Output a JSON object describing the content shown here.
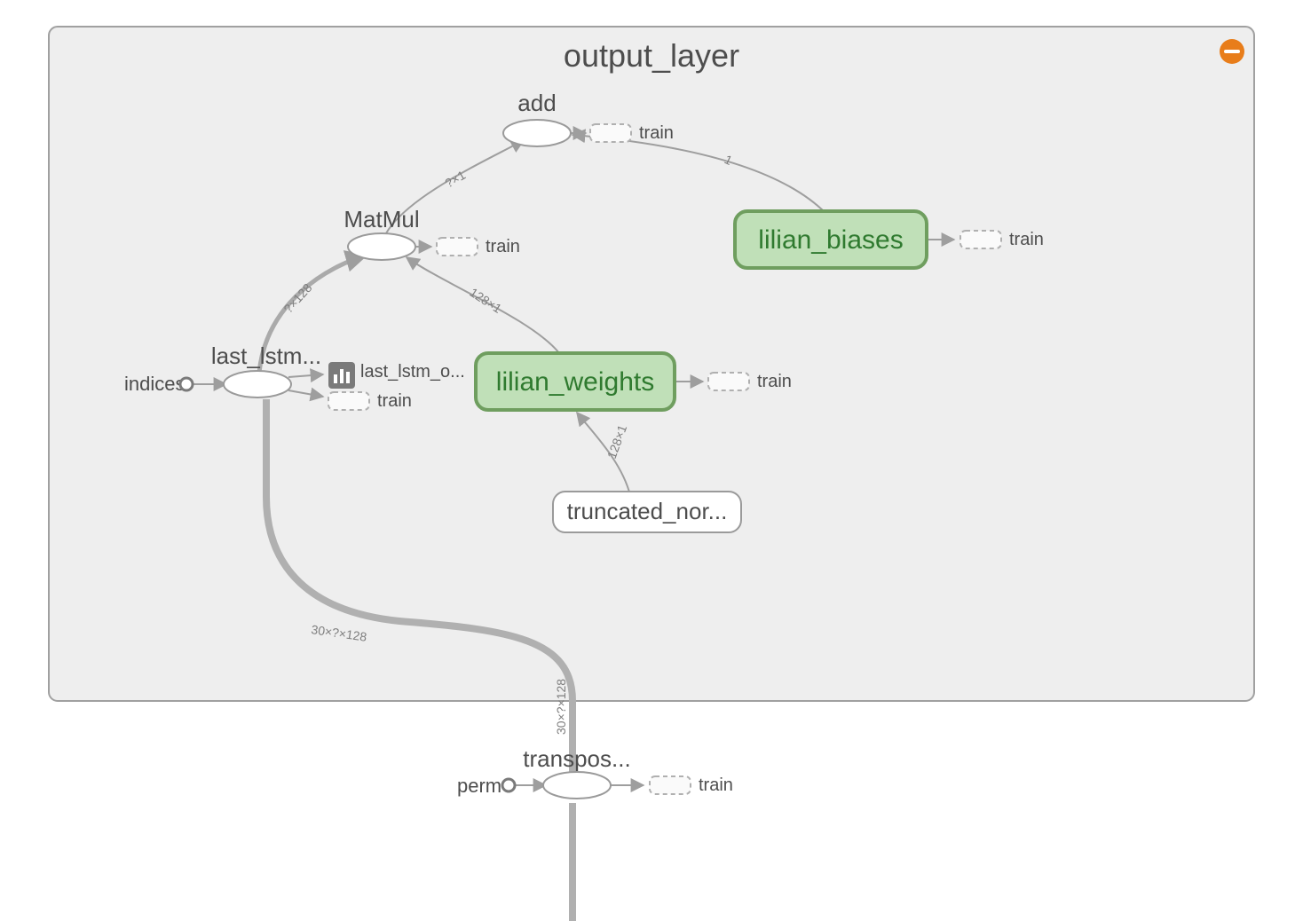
{
  "scope": {
    "title": "output_layer"
  },
  "ops": {
    "add": {
      "label": "add"
    },
    "matmul": {
      "label": "MatMul"
    },
    "last_lstm": {
      "label": "last_lstm...",
      "aux_label": "last_lstm_o..."
    },
    "transpose": {
      "label": "transpos..."
    }
  },
  "vars": {
    "biases": {
      "label": "lilian_biases"
    },
    "weights": {
      "label": "lilian_weights"
    }
  },
  "subops": {
    "truncated": {
      "label": "truncated_nor..."
    }
  },
  "consts": {
    "indices": {
      "label": "indices"
    },
    "perm": {
      "label": "perm"
    }
  },
  "aux": {
    "train": "train"
  },
  "edge_shapes": {
    "add_matmul": "?×1",
    "matmul_lilianw": "128×1",
    "matmul_lstm": "?×128",
    "lstm_tp": "30×?×128",
    "lilianw_trunc": "128×1",
    "add_biases": "1",
    "tp_in": "30×?×128"
  },
  "colors": {
    "scope_bg": "#eeeeee",
    "scope_stroke": "#a0a0a0",
    "var_fill": "#c0e0b8",
    "var_stroke": "#6f9e5f",
    "accent": "#e87d1a",
    "edge": "#9e9e9e",
    "edge_thick": "#b0b0b0"
  }
}
